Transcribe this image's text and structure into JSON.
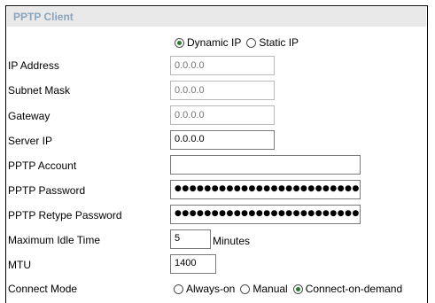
{
  "panel": {
    "title": "PPTP Client"
  },
  "ip_mode": {
    "dynamic_label": "Dynamic IP",
    "static_label": "Static IP",
    "selected": "dynamic"
  },
  "fields": {
    "ip_address": {
      "label": "IP Address",
      "placeholder": "0.0.0.0"
    },
    "subnet_mask": {
      "label": "Subnet Mask",
      "placeholder": "0.0.0.0"
    },
    "gateway": {
      "label": "Gateway",
      "placeholder": "0.0.0.0"
    },
    "server_ip": {
      "label": "Server IP",
      "value": "0.0.0.0"
    },
    "account": {
      "label": "PPTP Account",
      "value": ""
    },
    "password": {
      "label": "PPTP Password",
      "value": "●●●●●●●●●●●●●●●●●●●●●●●●●●●●●●●●●●●●●●●●●●●●●●"
    },
    "retype_password": {
      "label": "PPTP Retype Password",
      "value": "●●●●●●●●●●●●●●●●●●●●●●●●●●●●●●●●●●●●●●●●●●●●●●"
    },
    "idle_time": {
      "label": "Maximum Idle Time",
      "value": "5",
      "unit": "Minutes"
    },
    "mtu": {
      "label": "MTU",
      "value": "1400"
    }
  },
  "connect_mode": {
    "label": "Connect Mode",
    "always_on_label": "Always-on",
    "manual_label": "Manual",
    "on_demand_label": "Connect-on-demand",
    "selected": "on-demand"
  }
}
